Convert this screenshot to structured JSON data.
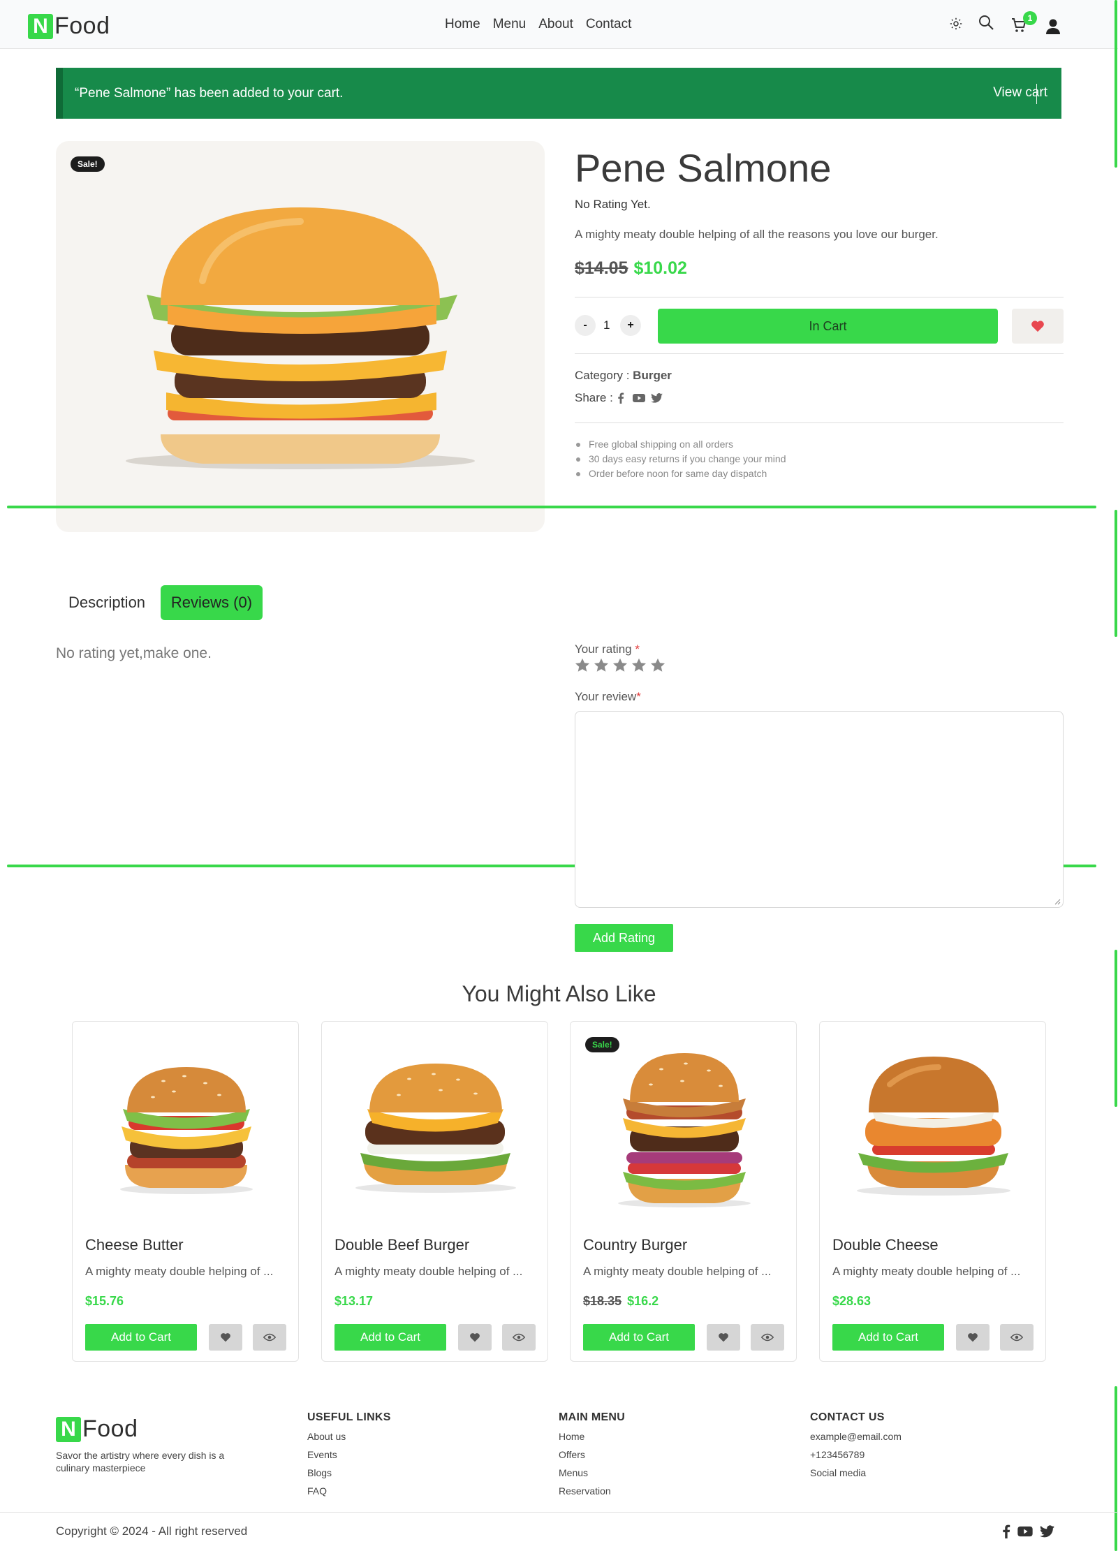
{
  "header": {
    "logo_letter": "N",
    "logo_text": "Food",
    "nav": [
      "Home",
      "Menu",
      "About",
      "Contact"
    ],
    "cart_count": "1",
    "icons": [
      "theme-toggle-icon",
      "search-icon",
      "cart-icon",
      "user-icon"
    ]
  },
  "notice": {
    "message": "“Pene Salmone” has been added to your cart.",
    "link": "View cart"
  },
  "product": {
    "sale_badge": "Sale!",
    "title": "Pene Salmone",
    "rating_text": "No Rating Yet.",
    "description": "A mighty meaty double helping of all the reasons you love our burger.",
    "old_price": "$14.05",
    "new_price": "$10.02",
    "qty_minus": "-",
    "qty": "1",
    "qty_plus": "+",
    "cart_button": "In Cart",
    "category_label": "Category :",
    "category_value": "Burger",
    "share_label": "Share :",
    "share_icons": [
      "facebook-icon",
      "youtube-icon",
      "twitter-icon"
    ],
    "bullets": [
      "Free global shipping on all orders",
      "30 days easy returns if you change your mind",
      "Order before noon for same day dispatch"
    ]
  },
  "tabs": {
    "description": "Description",
    "reviews": "Reviews (0)"
  },
  "reviews": {
    "empty_text": "No rating yet,make one.",
    "rating_label": "Your rating",
    "rating_required": "*",
    "star_count": 5,
    "review_label": "Your review",
    "review_required": "*",
    "submit": "Add Rating"
  },
  "related": {
    "title": "You Might Also Like",
    "items": [
      {
        "name": "Cheese Butter",
        "desc": "A mighty meaty double helping of ...",
        "old_price": "",
        "price": "$15.76",
        "sale": "",
        "button": "Add to Cart"
      },
      {
        "name": "Double Beef Burger",
        "desc": "A mighty meaty double helping of ...",
        "old_price": "",
        "price": "$13.17",
        "sale": "",
        "button": "Add to Cart"
      },
      {
        "name": "Country Burger",
        "desc": "A mighty meaty double helping of ...",
        "old_price": "$18.35",
        "price": "$16.2",
        "sale": "Sale!",
        "button": "Add to Cart"
      },
      {
        "name": "Double Cheese",
        "desc": "A mighty meaty double helping of ...",
        "old_price": "",
        "price": "$28.63",
        "sale": "",
        "button": "Add to Cart"
      }
    ]
  },
  "footer": {
    "logo_letter": "N",
    "logo_text": "Food",
    "tagline": "Savor the artistry where every dish is a culinary masterpiece",
    "useful_links": {
      "title": "USEFUL LINKS",
      "items": [
        "About us",
        "Events",
        "Blogs",
        "FAQ"
      ]
    },
    "main_menu": {
      "title": "MAIN MENU",
      "items": [
        "Home",
        "Offers",
        "Menus",
        "Reservation"
      ]
    },
    "contact": {
      "title": "CONTACT US",
      "items": [
        "example@email.com",
        "+123456789",
        "Social media"
      ]
    },
    "copyright": "Copyright © 2024 - All right reserved",
    "social_icons": [
      "facebook-icon",
      "youtube-icon",
      "twitter-icon"
    ]
  },
  "colors": {
    "accent": "#38d84a",
    "notice_bg": "#178a4a",
    "heart": "#e8474f"
  }
}
